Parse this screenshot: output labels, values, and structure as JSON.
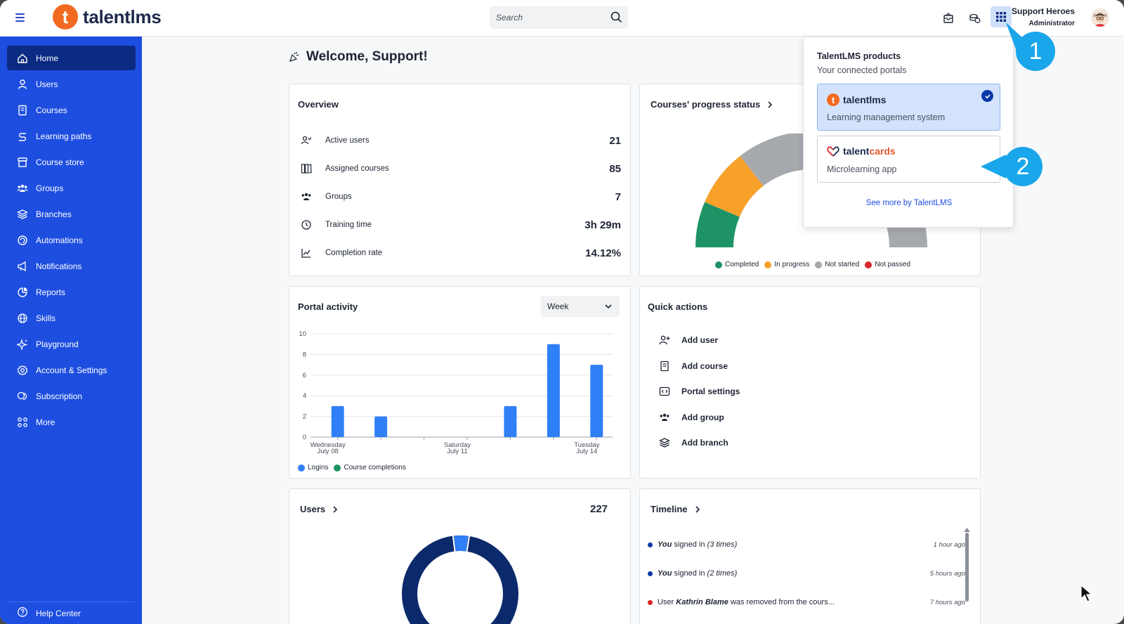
{
  "header": {
    "brand": "talentlms",
    "search_placeholder": "Search",
    "user_name": "Support Heroes",
    "user_role": "Administrator"
  },
  "sidebar": {
    "items": [
      {
        "label": "Home",
        "icon": "home-icon"
      },
      {
        "label": "Users",
        "icon": "user-icon"
      },
      {
        "label": "Courses",
        "icon": "book-icon"
      },
      {
        "label": "Learning paths",
        "icon": "path-icon"
      },
      {
        "label": "Course store",
        "icon": "store-icon"
      },
      {
        "label": "Groups",
        "icon": "groups-icon"
      },
      {
        "label": "Branches",
        "icon": "layers-icon"
      },
      {
        "label": "Automations",
        "icon": "automation-icon"
      },
      {
        "label": "Notifications",
        "icon": "megaphone-icon"
      },
      {
        "label": "Reports",
        "icon": "pie-icon"
      },
      {
        "label": "Skills",
        "icon": "globe-icon"
      },
      {
        "label": "Playground",
        "icon": "sparkle-icon"
      },
      {
        "label": "Account & Settings",
        "icon": "gear-icon"
      },
      {
        "label": "Subscription",
        "icon": "coins-icon"
      },
      {
        "label": "More",
        "icon": "grid-icon"
      }
    ],
    "help": "Help Center"
  },
  "main": {
    "welcome": "Welcome, Support!",
    "overview": {
      "title": "Overview",
      "rows": [
        {
          "label": "Active users",
          "value": "21"
        },
        {
          "label": "Assigned courses",
          "value": "85"
        },
        {
          "label": "Groups",
          "value": "7"
        },
        {
          "label": "Training time",
          "value": "3h 29m"
        },
        {
          "label": "Completion rate",
          "value": "14.12%"
        }
      ]
    },
    "progress": {
      "title": "Courses' progress status",
      "legend": [
        "Completed",
        "In progress",
        "Not started",
        "Not passed"
      ]
    },
    "activity": {
      "title": "Portal activity",
      "period": "Week",
      "legend": [
        "Logins",
        "Course completions"
      ]
    },
    "quick": {
      "title": "Quick actions",
      "items": [
        "Add user",
        "Add course",
        "Portal settings",
        "Add group",
        "Add branch"
      ]
    },
    "users": {
      "title": "Users",
      "count": "227"
    },
    "timeline": {
      "title": "Timeline",
      "events": [
        {
          "who": "You",
          "text": " signed in ",
          "extra": "(3 times)",
          "time": "1 hour ago",
          "color": "#0b3aa8"
        },
        {
          "who": "You",
          "text": " signed in ",
          "extra": "(2 times)",
          "time": "5 hours ago",
          "color": "#0b3aa8"
        },
        {
          "who_prefix": "User ",
          "who": "Kathrin Blame",
          "text": " was removed from the cours...",
          "time": "7 hours ago",
          "color": "#e02020"
        }
      ]
    }
  },
  "products_menu": {
    "title": "TalentLMS products",
    "subtitle": "Your connected portals",
    "products": [
      {
        "name": "talentlms",
        "desc": "Learning management system"
      },
      {
        "name_a": "talent",
        "name_b": "cards",
        "desc": "Microlearning app"
      }
    ],
    "see_more": "See more by TalentLMS"
  },
  "callouts": [
    "1",
    "2"
  ],
  "chart_data": [
    {
      "type": "bar",
      "categories": [
        "Wednesday July 08",
        "",
        "",
        "Saturday July 11",
        "",
        "",
        "Tuesday July 14",
        ""
      ],
      "tick_labels": [
        [
          "Wednesday",
          "July 08"
        ],
        [
          "Saturday",
          "July 11"
        ],
        [
          "Tuesday",
          "July 14"
        ]
      ],
      "series": [
        {
          "name": "Logins",
          "values": [
            3,
            2,
            0,
            0,
            3,
            9,
            7
          ],
          "color": "#2f80f7"
        },
        {
          "name": "Course completions",
          "values": [
            0,
            0,
            0,
            0,
            0,
            0,
            0
          ],
          "color": "#1e9365"
        }
      ],
      "ylim": [
        0,
        10
      ],
      "yticks": [
        0,
        2,
        4,
        6,
        8,
        10
      ],
      "grid": true
    },
    {
      "type": "pie",
      "labels": [
        "Completed",
        "In progress",
        "Not started",
        "Not passed"
      ],
      "colors": [
        "#1e9365",
        "#f7a12b",
        "#a6a9ad",
        "#d9292b"
      ]
    },
    {
      "type": "pie",
      "labels": [
        "Users"
      ],
      "colors": [
        "#0b2a6b",
        "#2f80f7"
      ]
    }
  ]
}
